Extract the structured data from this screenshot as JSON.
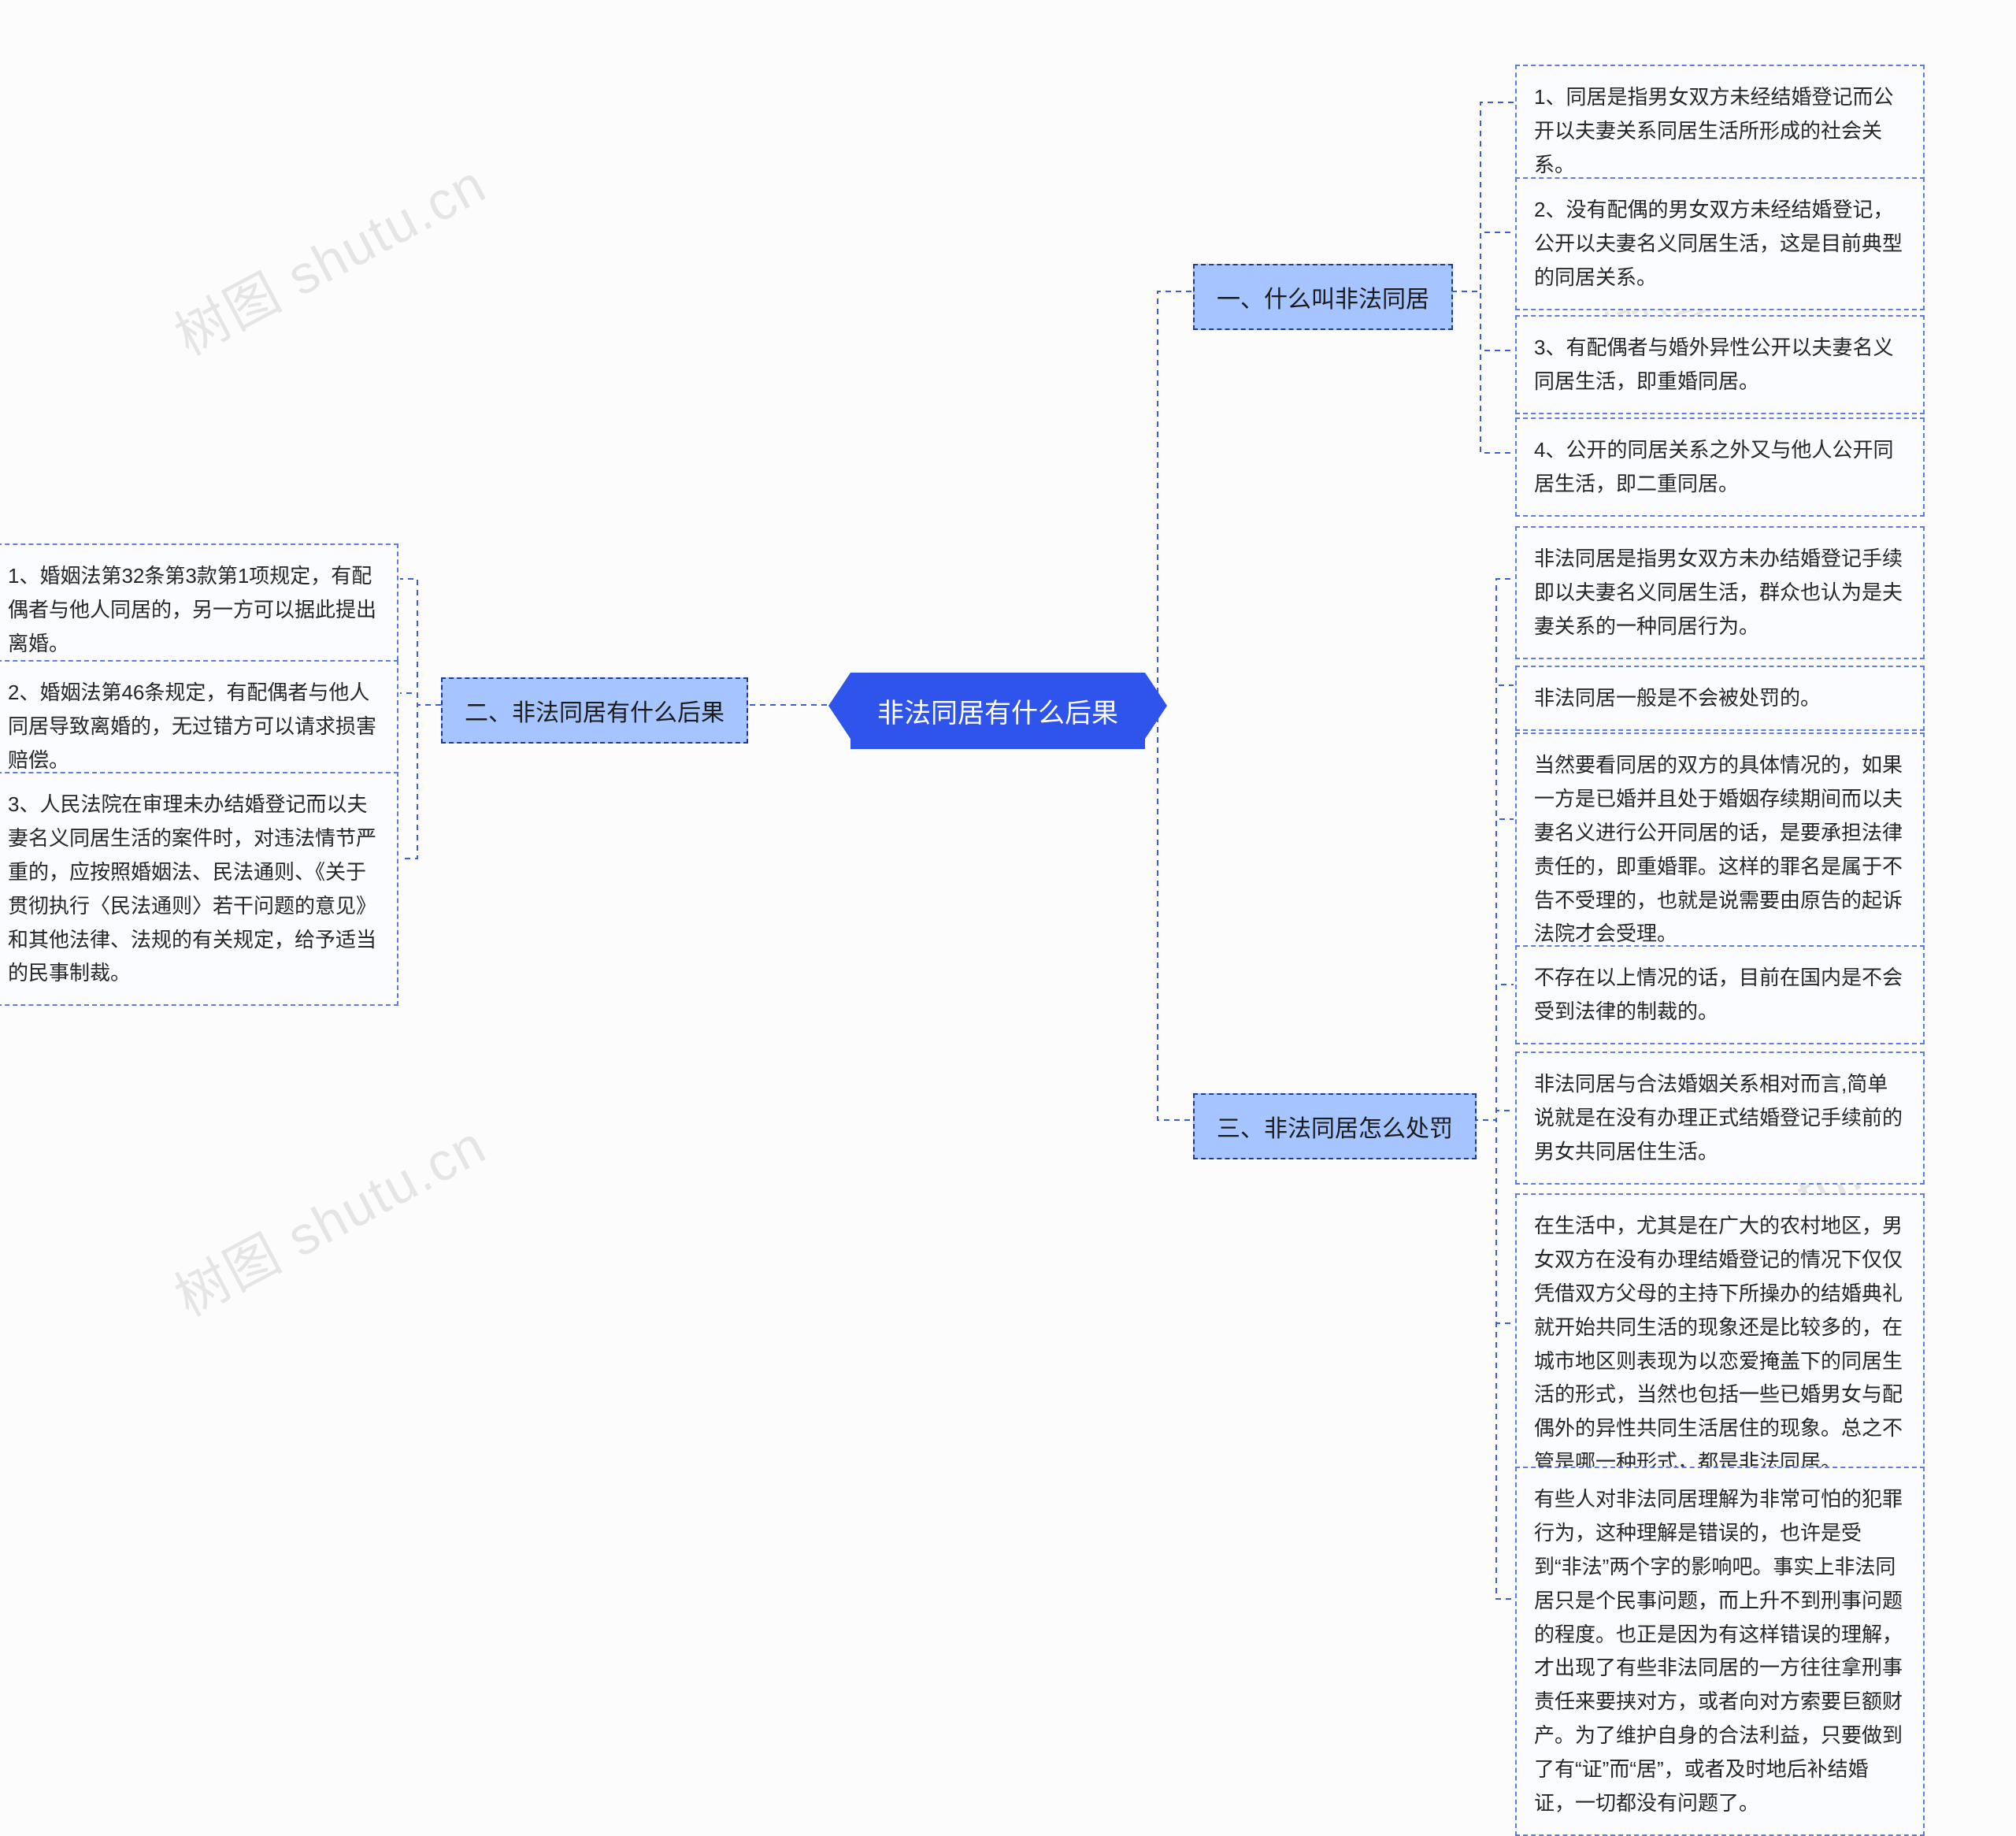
{
  "watermark": "树图 shutu.cn",
  "root": {
    "title": "非法同居有什么后果"
  },
  "branch1": {
    "title": "一、什么叫非法同居",
    "items": [
      "1、同居是指男女双方未经结婚登记而公开以夫妻关系同居生活所形成的社会关系。",
      "2、没有配偶的男女双方未经结婚登记，公开以夫妻名义同居生活，这是目前典型的同居关系。",
      "3、有配偶者与婚外异性公开以夫妻名义同居生活，即重婚同居。",
      "4、公开的同居关系之外又与他人公开同居生活，即二重同居。"
    ]
  },
  "branch2": {
    "title": "二、非法同居有什么后果",
    "items": [
      "1、婚姻法第32条第3款第1项规定，有配偶者与他人同居的，另一方可以据此提出离婚。",
      "2、婚姻法第46条规定，有配偶者与他人同居导致离婚的，无过错方可以请求损害赔偿。",
      "3、人民法院在审理未办结婚登记而以夫妻名义同居生活的案件时，对违法情节严重的，应按照婚姻法、民法通则、《关于贯彻执行〈民法通则〉若干问题的意见》和其他法律、法规的有关规定，给予适当的民事制裁。"
    ]
  },
  "branch3": {
    "title": "三、非法同居怎么处罚",
    "items": [
      "非法同居是指男女双方未办结婚登记手续即以夫妻名义同居生活，群众也认为是夫妻关系的一种同居行为。",
      "非法同居一般是不会被处罚的。",
      "当然要看同居的双方的具体情况的，如果一方是已婚并且处于婚姻存续期间而以夫妻名义进行公开同居的话，是要承担法律责任的，即重婚罪。这样的罪名是属于不告不受理的，也就是说需要由原告的起诉法院才会受理。",
      "不存在以上情况的话，目前在国内是不会受到法律的制裁的。",
      "非法同居与合法婚姻关系相对而言,简单说就是在没有办理正式结婚登记手续前的男女共同居住生活。",
      "在生活中，尤其是在广大的农村地区，男女双方在没有办理结婚登记的情况下仅仅凭借双方父母的主持下所操办的结婚典礼就开始共同生活的现象还是比较多的，在城市地区则表现为以恋爱掩盖下的同居生活的形式，当然也包括一些已婚男女与配偶外的异性共同生活居住的现象。总之不管是哪一种形式，都是非法同居。",
      "有些人对非法同居理解为非常可怕的犯罪行为，这种理解是错误的，也许是受到“非法”两个字的影响吧。事实上非法同居只是个民事问题，而上升不到刑事问题的程度。也正是因为有这样错误的理解，才出现了有些非法同居的一方往往拿刑事责任来要挟对方，或者向对方索要巨额财产。为了维护自身的合法利益，只要做到了有“证”而“居”，或者及时地后补结婚证，一切都没有问题了。"
    ]
  }
}
